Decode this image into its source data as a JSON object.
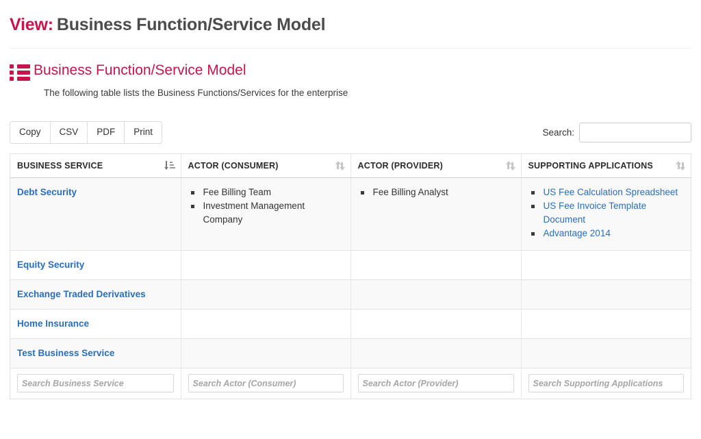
{
  "view": {
    "label": "View:",
    "title": "Business Function/Service Model"
  },
  "section": {
    "icon": "list-icon",
    "title": "Business Function/Service Model",
    "subtitle": "The following table lists the Business Functions/Services for the enterprise"
  },
  "toolbar": {
    "buttons": [
      {
        "label": "Copy",
        "name": "copy-button"
      },
      {
        "label": "CSV",
        "name": "csv-button"
      },
      {
        "label": "PDF",
        "name": "pdf-button"
      },
      {
        "label": "Print",
        "name": "print-button"
      }
    ],
    "search_label": "Search:",
    "search_value": "",
    "search_placeholder": ""
  },
  "table": {
    "columns": [
      {
        "header": "BUSINESS SERVICE",
        "sort": "asc",
        "filter_placeholder": "Search Business Service"
      },
      {
        "header": "ACTOR (CONSUMER)",
        "sort": "none",
        "filter_placeholder": "Search Actor (Consumer)"
      },
      {
        "header": "ACTOR (PROVIDER)",
        "sort": "none",
        "filter_placeholder": "Search Actor (Provider)"
      },
      {
        "header": "SUPPORTING APPLICATIONS",
        "sort": "none",
        "filter_placeholder": "Search Supporting Applications"
      }
    ],
    "rows": [
      {
        "service": "Debt Security",
        "consumers": [
          "Fee Billing Team",
          "Investment Management Company"
        ],
        "providers": [
          "Fee Billing Analyst"
        ],
        "applications": [
          "US Fee Calculation Spreadsheet",
          "US Fee Invoice Template Document",
          "Advantage 2014"
        ]
      },
      {
        "service": "Equity Security",
        "consumers": [],
        "providers": [],
        "applications": []
      },
      {
        "service": "Exchange Traded Derivatives",
        "consumers": [],
        "providers": [],
        "applications": []
      },
      {
        "service": "Home Insurance",
        "consumers": [],
        "providers": [],
        "applications": []
      },
      {
        "service": "Test Business Service",
        "consumers": [],
        "providers": [],
        "applications": []
      }
    ]
  },
  "colors": {
    "brand_crimson": "#c8154b",
    "link_blue": "#2a6ebb",
    "title_gray": "#4c4c4c",
    "row_stripe": "#f9f9f9",
    "border": "#e2e2e2"
  }
}
